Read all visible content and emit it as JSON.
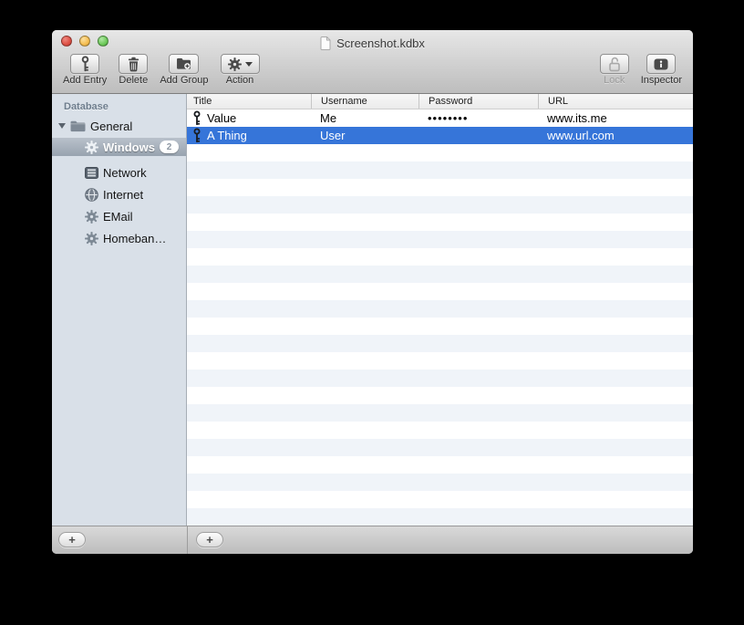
{
  "window": {
    "title": "Screenshot.kdbx",
    "controls": [
      "close",
      "minimize",
      "zoom"
    ]
  },
  "toolbar": {
    "buttons_left": [
      {
        "label": "Add Entry",
        "icon": "key-icon"
      },
      {
        "label": "Delete",
        "icon": "trash-icon"
      },
      {
        "label": "Add Group",
        "icon": "folder-plus-icon"
      },
      {
        "label": "Action",
        "icon": "gear-icon",
        "has_dropdown": true
      }
    ],
    "buttons_right": [
      {
        "label": "Lock",
        "icon": "lock-open-icon",
        "disabled": true
      },
      {
        "label": "Inspector",
        "icon": "info-icon",
        "disabled": false
      }
    ]
  },
  "sidebar": {
    "header": "Database",
    "items": [
      {
        "label": "General",
        "icon": "folder-icon",
        "expanded": true,
        "level": 0
      },
      {
        "label": "Windows",
        "icon": "gear-icon",
        "badge": "2",
        "selected": true,
        "level": 1
      },
      {
        "label": "Network",
        "icon": "network-icon",
        "level": 1
      },
      {
        "label": "Internet",
        "icon": "globe-icon",
        "level": 1
      },
      {
        "label": "EMail",
        "icon": "gear-icon",
        "level": 1
      },
      {
        "label": "Homeban…",
        "icon": "gear-icon",
        "level": 1
      }
    ]
  },
  "table": {
    "columns": [
      {
        "label": "Title"
      },
      {
        "label": "Username"
      },
      {
        "label": "Password"
      },
      {
        "label": "URL"
      }
    ],
    "rows": [
      {
        "title": "Value",
        "username": "Me",
        "password": "••••••••",
        "url": "www.its.me",
        "selected": false
      },
      {
        "title": "A Thing",
        "username": "User",
        "password": "",
        "url": "www.url.com",
        "selected": true
      }
    ]
  },
  "bottom_bar": {
    "sidebar_add_label": "+",
    "table_add_label": "+"
  },
  "colors": {
    "selection_blue": "#3675d9",
    "stripe_blue": "#f0f4f9",
    "sidebar_bg": "#d9e0e8",
    "chrome_top": "#e7e7e7",
    "chrome_bottom": "#bdbdbd",
    "sel_group_top": "#b9c1cb",
    "sel_group_bottom": "#98a3af",
    "t_red": "#dd4f43",
    "t_yellow": "#f5bd4f",
    "t_green": "#6cc958"
  }
}
